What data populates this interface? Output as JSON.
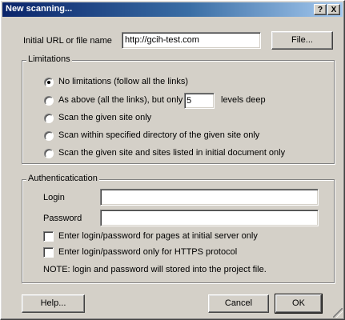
{
  "window": {
    "title": "New scanning...",
    "help_btn": "?",
    "close_btn": "X"
  },
  "url_row": {
    "label": "Initial URL or file name",
    "value": "http://gcih-test.com",
    "file_button": "File..."
  },
  "limitations": {
    "legend": "Limitations",
    "options": [
      {
        "label": "No limitations (follow all the links)",
        "selected": true
      },
      {
        "label": "As above (all the links), but only",
        "selected": false
      },
      {
        "label": "Scan the given site only",
        "selected": false
      },
      {
        "label": "Scan within specified directory of the given site only",
        "selected": false
      },
      {
        "label": "Scan the given site and sites listed in initial document only",
        "selected": false
      }
    ],
    "depth_value": "5",
    "depth_suffix": "levels deep"
  },
  "auth": {
    "legend": "Authenticatication",
    "login_label": "Login",
    "login_value": "",
    "password_label": "Password",
    "password_value": "",
    "check1": "Enter login/password for pages at initial server only",
    "check2": "Enter login/password only for HTTPS protocol",
    "note": "NOTE: login and password will stored into the project file."
  },
  "buttons": {
    "help": "Help...",
    "cancel": "Cancel",
    "ok": "OK"
  }
}
